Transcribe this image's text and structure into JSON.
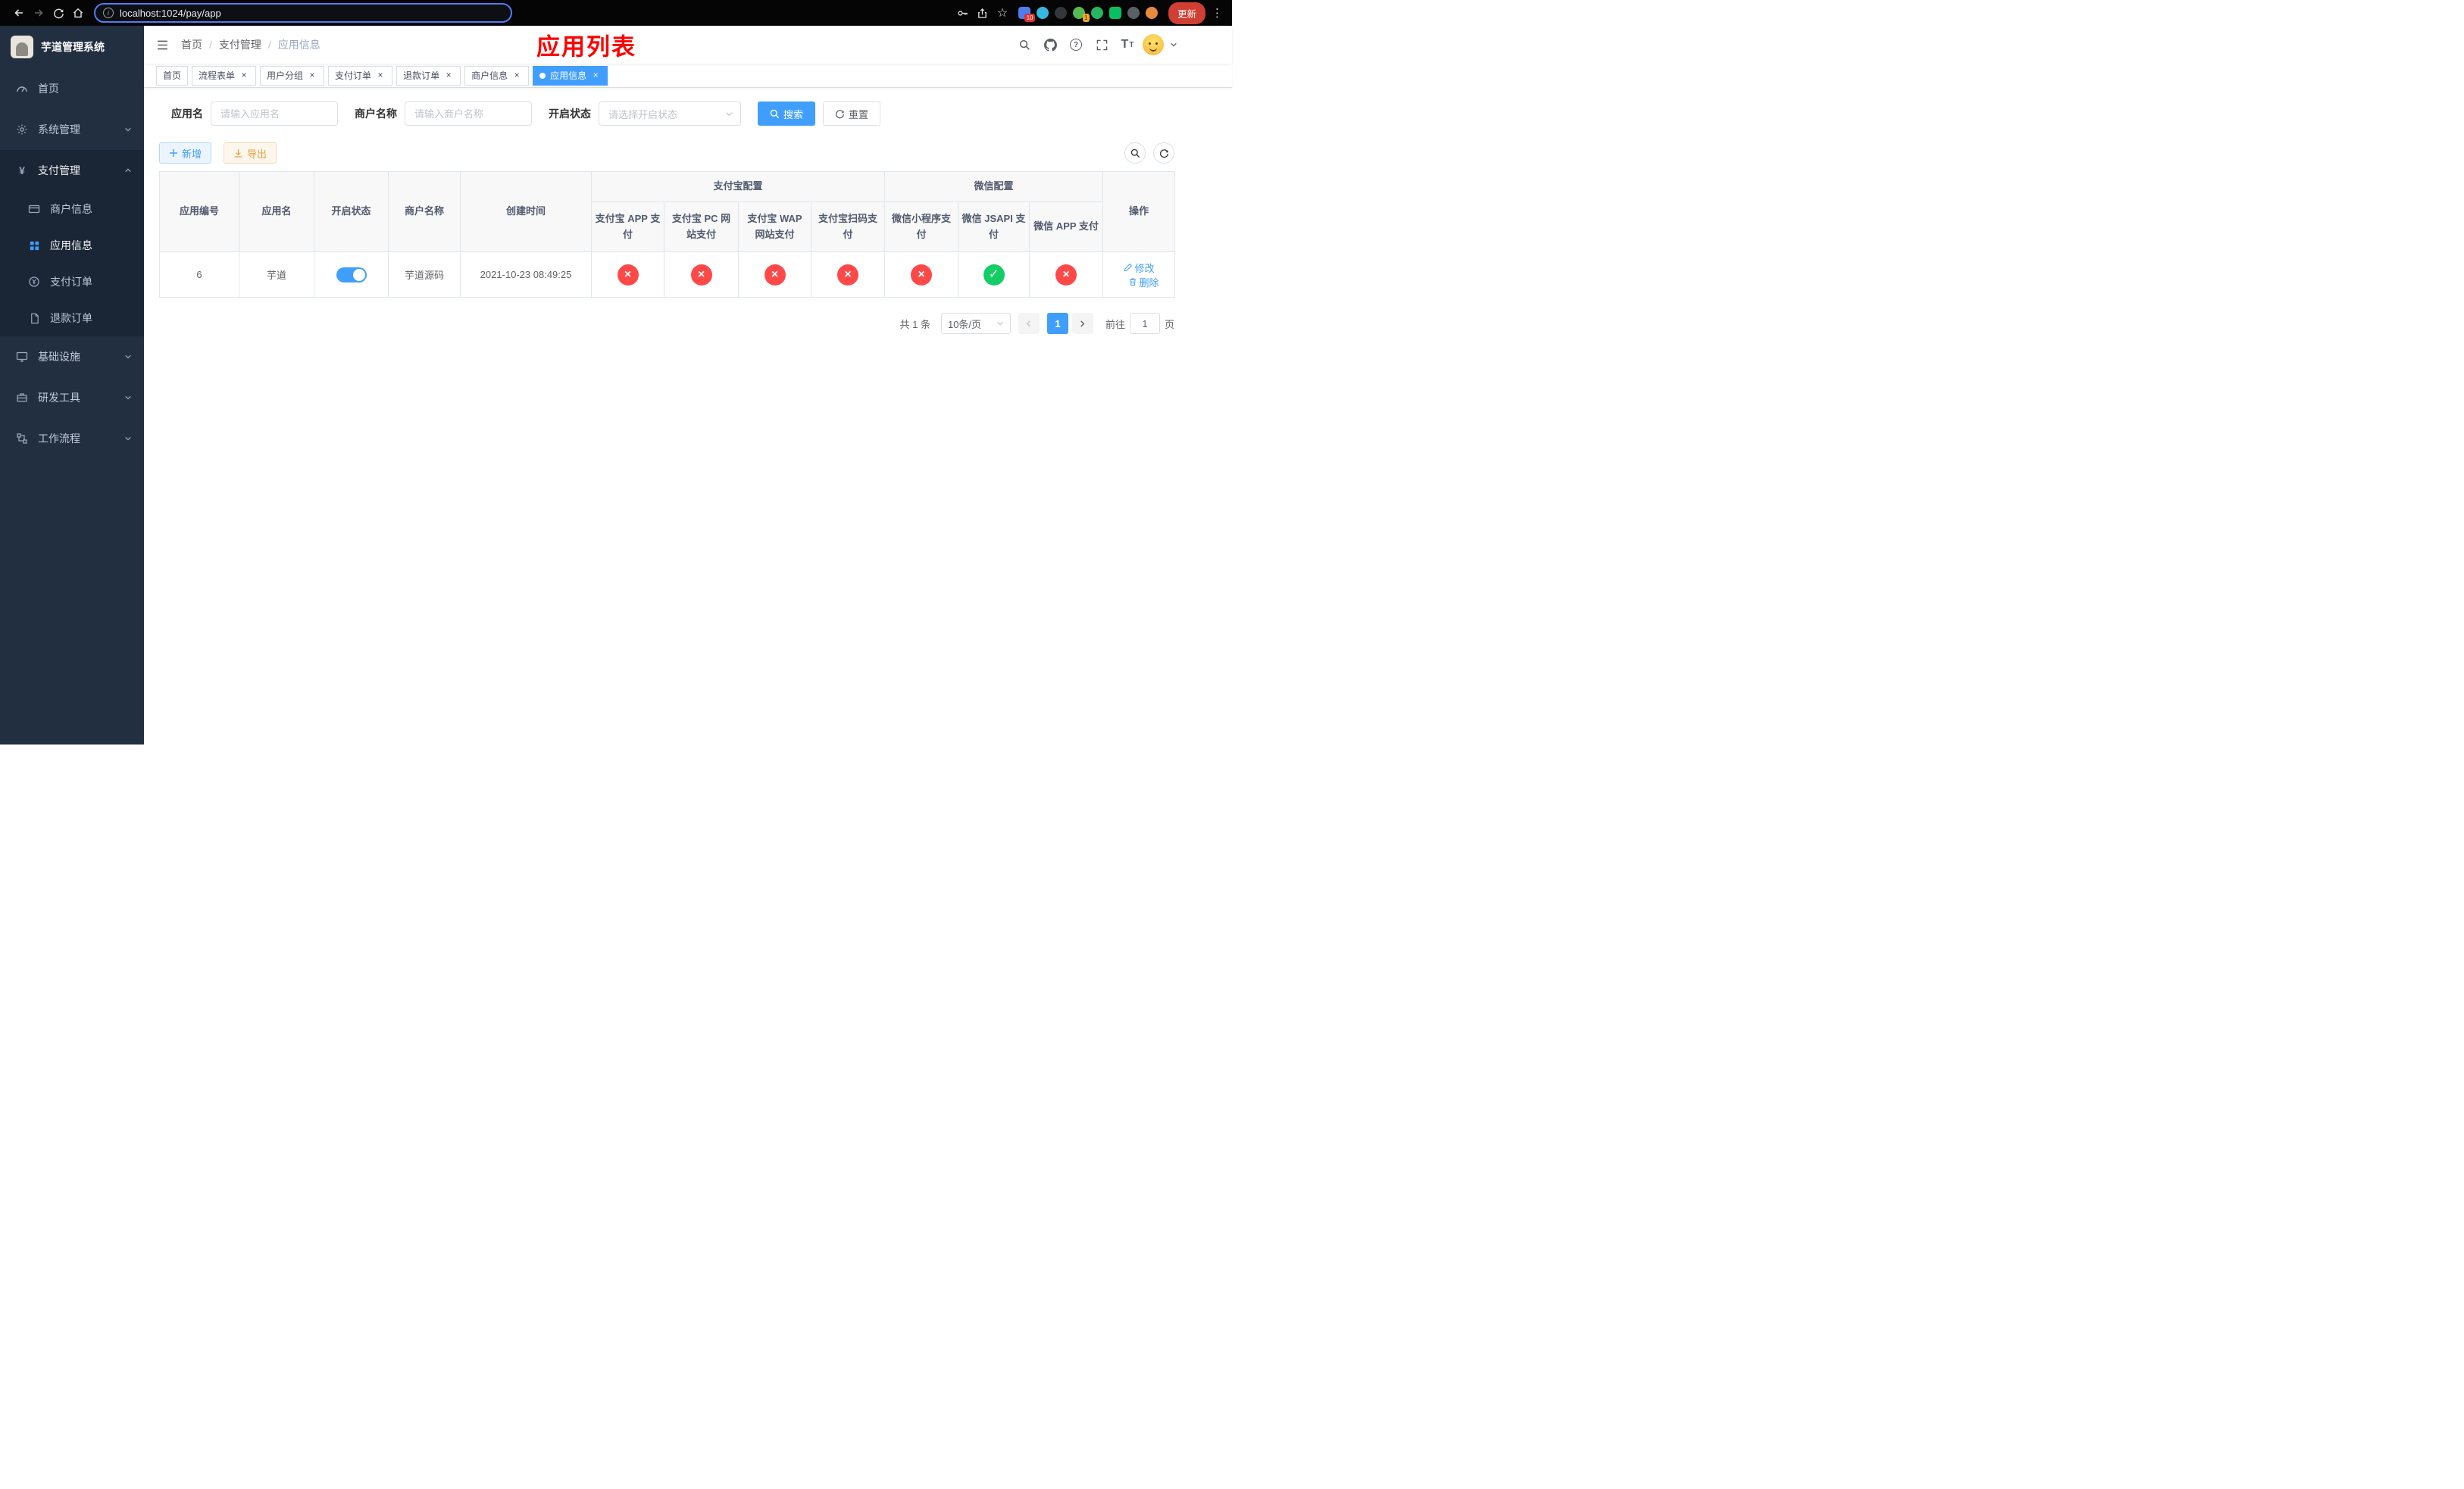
{
  "colors": {
    "accent": "#409eff",
    "success": "#13ce66",
    "danger": "#ff4949",
    "warning": "#e6a23c",
    "page_title_red": "#ff0000",
    "sidebar_bg": "#222f41"
  },
  "icons": {
    "close_glyph": "×",
    "enabled_glyph": "✓",
    "disabled_glyph": "×",
    "info_glyph": "i",
    "more_glyph": "⋮",
    "star_glyph": "☆"
  },
  "browser": {
    "url": "localhost:1024/pay/app",
    "update_label": "更新",
    "extension_badges": {
      "first": "10",
      "second": "1"
    }
  },
  "sidebar": {
    "app_title": "芋道管理系统",
    "items": {
      "home": "首页",
      "system": "系统管理",
      "pay": "支付管理",
      "merchant_info": "商户信息",
      "app_info": "应用信息",
      "pay_order": "支付订单",
      "refund_order": "退款订单",
      "infra": "基础设施",
      "devtools": "研发工具",
      "workflow": "工作流程"
    }
  },
  "navbar": {
    "breadcrumb": {
      "level1": "首页",
      "level2": "支付管理",
      "level3": "应用信息",
      "separator": "/"
    },
    "page_title": "应用列表"
  },
  "tabs": [
    {
      "label": "首页",
      "closable": false,
      "active": false
    },
    {
      "label": "流程表单",
      "closable": true,
      "active": false
    },
    {
      "label": "用户分组",
      "closable": true,
      "active": false
    },
    {
      "label": "支付订单",
      "closable": true,
      "active": false
    },
    {
      "label": "退款订单",
      "closable": true,
      "active": false
    },
    {
      "label": "商户信息",
      "closable": true,
      "active": false
    },
    {
      "label": "应用信息",
      "closable": true,
      "active": true
    }
  ],
  "filter": {
    "app_name": {
      "label": "应用名",
      "placeholder": "请输入应用名",
      "value": ""
    },
    "merchant_name": {
      "label": "商户名称",
      "placeholder": "请输入商户名称",
      "value": ""
    },
    "status": {
      "label": "开启状态",
      "placeholder": "请选择开启状态"
    },
    "search_label": "搜索",
    "reset_label": "重置"
  },
  "toolbar": {
    "add_label": "新增",
    "export_label": "导出"
  },
  "table": {
    "groups": {
      "alipay": "支付宝配置",
      "wechat": "微信配置"
    },
    "cols": {
      "app_id": "应用编号",
      "app_name": "应用名",
      "status": "开启状态",
      "merchant": "商户名称",
      "created": "创建时间",
      "alipay_app": "支付宝 APP 支付",
      "alipay_pc": "支付宝 PC 网站支付",
      "alipay_wap": "支付宝 WAP 网站支付",
      "alipay_qr": "支付宝扫码支付",
      "wx_lite": "微信小程序支付",
      "wx_jsapi": "微信 JSAPI 支付",
      "wx_app": "微信 APP 支付",
      "actions": "操作"
    },
    "row": {
      "app_id": "6",
      "app_name": "芋道",
      "enabled": true,
      "merchant": "芋道源码",
      "created": "2021-10-23 08:49:25",
      "configs": {
        "alipay_app": false,
        "alipay_pc": false,
        "alipay_wap": false,
        "alipay_qr": false,
        "wx_lite": false,
        "wx_jsapi": true,
        "wx_app": false
      },
      "edit_label": "修改",
      "delete_label": "删除"
    }
  },
  "pagination": {
    "total": "共 1 条",
    "page_size": "10条/页",
    "page": "1",
    "goto_prefix": "前往",
    "goto_value": "1",
    "goto_suffix": "页"
  }
}
